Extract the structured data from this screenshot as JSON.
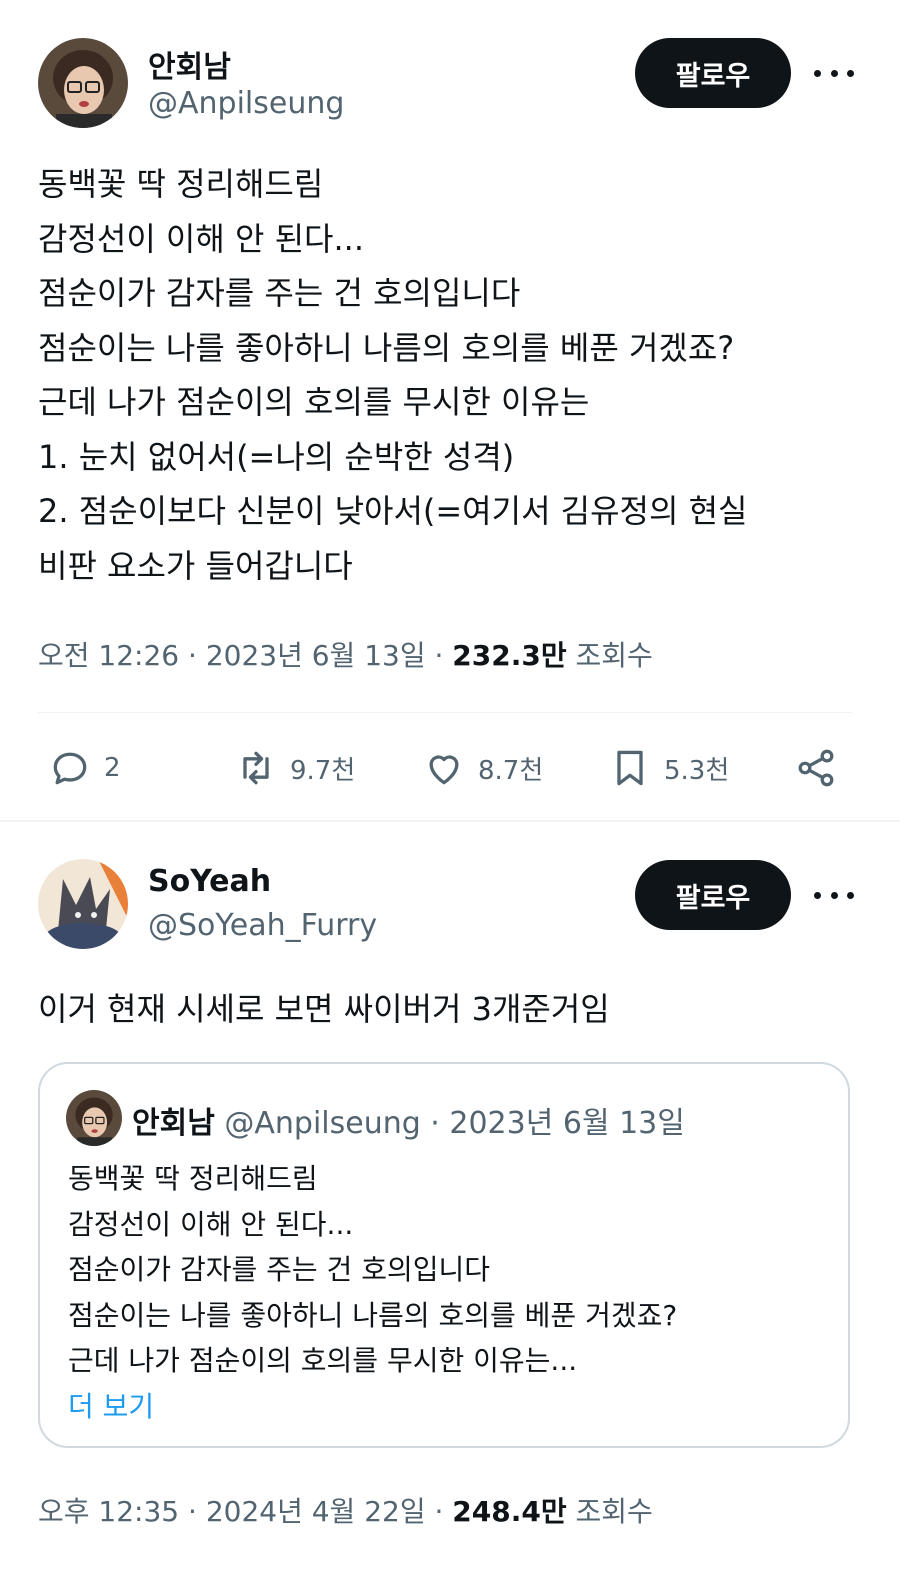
{
  "post": {
    "author_name": "안회남",
    "author_handle": "@Anpilseung",
    "follow_label": "팔로우",
    "lines": [
      "동백꽃 딱 정리해드림",
      "감정선이 이해 안 된다...",
      "점순이가 감자를 주는 건 호의입니다",
      "점순이는 나를 좋아하니 나름의 호의를 베푼 거겠죠?",
      "근데 나가 점순이의 호의를 무시한 이유는",
      "1. 눈치 없어서(=나의 순박한 성격)",
      "2. 점순이보다 신분이 낮아서(=여기서 김유정의 현실",
      "비판 요소가 들어갑니다"
    ],
    "time": "오전 12:26 · 2023년 6월 13일 · ",
    "views": "232.3만",
    "views_label": " 조회수",
    "actions": {
      "replies": "2",
      "reposts": "9.7천",
      "likes": "8.7천",
      "bookmarks": "5.3천"
    }
  },
  "reply": {
    "author_name": "SoYeah",
    "author_handle": "@SoYeah_Furry",
    "follow_label": "팔로우",
    "text": "이거 현재 시세로 보면 싸이버거 3개준거임",
    "quote": {
      "author_name": "안회남",
      "author_handle": "@Anpilseung · 2023년 6월 13일",
      "lines": [
        "동백꽃 딱 정리해드림",
        "감정선이 이해 안 된다...",
        "점순이가 감자를 주는 건 호의입니다",
        "점순이는 나를 좋아하니 나름의 호의를 베푼 거겠죠?",
        "근데 나가 점순이의 호의를 무시한 이유는..."
      ],
      "show_more": "더 보기"
    },
    "time": "오후 12:35 · 2024년 4월 22일 · ",
    "views": "248.4만",
    "views_label": " 조회수"
  },
  "colors": {
    "text_primary": "#0f1419",
    "text_secondary": "#536471",
    "link": "#1d9bf0",
    "button_bg": "#0f1419"
  },
  "icons": [
    "reply-icon",
    "repost-icon",
    "like-icon",
    "bookmark-icon",
    "share-icon",
    "more-icon"
  ]
}
